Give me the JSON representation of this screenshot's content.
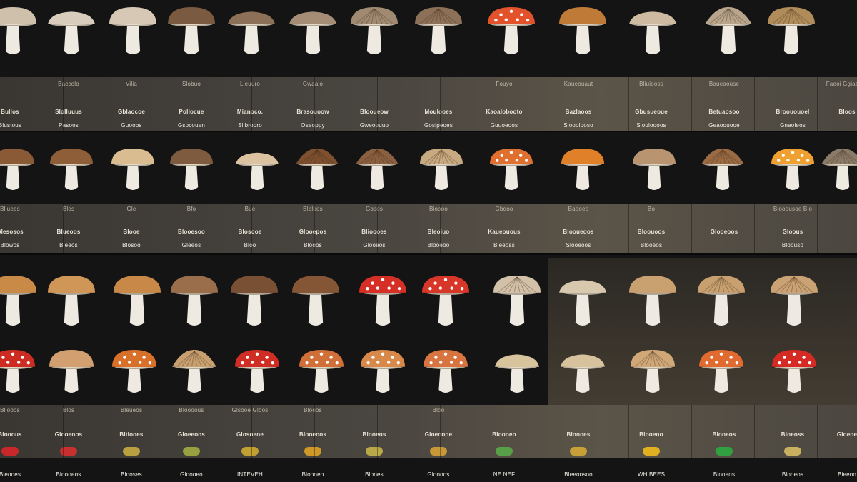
{
  "palette": {
    "background": "#141414",
    "label_band": "#4a4640",
    "stem": "#eeeae2",
    "cap_red": "#d93a2a",
    "cap_orange": "#e07a2a",
    "cap_brown": "#7a5236",
    "cap_tan": "#c8a478",
    "spot": "#ffffff"
  },
  "rows": [
    {
      "name": "row-1",
      "mushrooms": [
        {
          "cap": "#cfc0ab",
          "shape": "dome"
        },
        {
          "cap": "#d8ccbc",
          "shape": "flat"
        },
        {
          "cap": "#d6c8b4",
          "shape": "dome"
        },
        {
          "cap": "#7a5a40",
          "shape": "dome"
        },
        {
          "cap": "#8c7058",
          "shape": "flat"
        },
        {
          "cap": "#a58c74",
          "shape": "flat"
        },
        {
          "cap": "#a08a72",
          "shape": "gill"
        },
        {
          "cap": "#8d7058",
          "shape": "gill"
        },
        {
          "cap": "#e2532c",
          "shape": "spotted"
        },
        {
          "cap": "#c07a38",
          "shape": "dome"
        },
        {
          "cap": "#cdbaa0",
          "shape": "flat"
        },
        {
          "cap": "#b9a58c",
          "shape": "textured"
        },
        {
          "cap": "#b08c5a",
          "shape": "gill"
        }
      ],
      "labels_top": [
        "",
        "Baccolo",
        "Vilia",
        "Slobuo",
        "Lleuuro",
        "Gwaalo",
        "",
        "",
        "Fouyo",
        "Kaueouaut",
        "Bliuiooss",
        "Baueaouse",
        "",
        "Faeoi Ggiaesdli"
      ],
      "labels_mid": [
        "Bullos",
        "Slolluuus",
        "Gblaocoe",
        "Pollocue",
        "Mianoco.",
        "Brasouoow",
        "Blooueow",
        "Moulooes",
        "Kaoalobooto",
        "Bazlaoos",
        "Gbusueoue",
        "Betuaosoo",
        "Broououoel",
        "Bloos"
      ],
      "labels_low": [
        "Blustous",
        "Pasoos",
        "Guoobs",
        "Gsocouen",
        "Sllbrooro",
        "Oseoppy",
        "Gweoouuo",
        "Goslpeoes",
        "Guuoeoos",
        "Slooolooso",
        "Slouloooos",
        "Geaoouooe",
        "Gnaoleos"
      ]
    },
    {
      "name": "row-2",
      "mushrooms": [
        {
          "cap": "#8a5a36",
          "shape": "dome"
        },
        {
          "cap": "#8e5e38",
          "shape": "dome"
        },
        {
          "cap": "#d9bc90",
          "shape": "dome"
        },
        {
          "cap": "#7e5a3e",
          "shape": "dome"
        },
        {
          "cap": "#dcc2a0",
          "shape": "flat"
        },
        {
          "cap": "#7e5030",
          "shape": "textured"
        },
        {
          "cap": "#8a6040",
          "shape": "textured"
        },
        {
          "cap": "#c8aa80",
          "shape": "gill"
        },
        {
          "cap": "#e07030",
          "shape": "spotted"
        },
        {
          "cap": "#e08028",
          "shape": "dome"
        },
        {
          "cap": "#b89470",
          "shape": "dome"
        },
        {
          "cap": "#9a6a44",
          "shape": "textured"
        },
        {
          "cap": "#f0a030",
          "shape": "spotted"
        },
        {
          "cap": "#8a7a68",
          "shape": "textured"
        }
      ],
      "labels_top": [
        "Bliuees",
        "Bles",
        "Gle",
        "Bfo",
        "Bue",
        "Blbleos",
        "Gbsos",
        "Bioaoo",
        "Gbooo",
        "Baooeo",
        "Bo",
        "",
        "Blooousoe Blo"
      ],
      "labels_mid": [
        "Glesosos",
        "Blueoos",
        "Blooe",
        "Blooesoo",
        "Blosooe",
        "Glooepos",
        "Blioooes",
        "Bleoiuo",
        "Kaueouous",
        "Blooueoos",
        "Bloouoos",
        "Glooeoos",
        "Gloous"
      ],
      "labels_low": [
        "Blowos",
        "Bleeos",
        "Blosoo",
        "Gleeos",
        "Bloo",
        "Blooos",
        "Glooeos",
        "Blooeoo",
        "Bleeoss",
        "Slooeoos",
        "Blooeos",
        "",
        "Bloouso"
      ]
    },
    {
      "name": "row-3",
      "mushrooms": [
        {
          "cap": "#c98a48",
          "shape": "dome"
        },
        {
          "cap": "#d09658",
          "shape": "dome"
        },
        {
          "cap": "#c88848",
          "shape": "dome"
        },
        {
          "cap": "#9a6e4a",
          "shape": "dome"
        },
        {
          "cap": "#7a5034",
          "shape": "dome"
        },
        {
          "cap": "#845636",
          "shape": "dome"
        },
        {
          "cap": "#d63026",
          "shape": "spotted"
        },
        {
          "cap": "#d83628",
          "shape": "spotted"
        },
        {
          "cap": "#d2c0a8",
          "shape": "gill"
        },
        {
          "cap": "#d8c8ae",
          "shape": "flat"
        },
        {
          "cap": "#c9a070",
          "shape": "dome"
        },
        {
          "cap": "#c8a070",
          "shape": "gill"
        },
        {
          "cap": "#caa274",
          "shape": "gill"
        }
      ]
    },
    {
      "name": "row-4",
      "mushrooms": [
        {
          "cap": "#cc2c22",
          "shape": "spotted"
        },
        {
          "cap": "#d2a070",
          "shape": "dome"
        },
        {
          "cap": "#d8702a",
          "shape": "spotted"
        },
        {
          "cap": "#c8a070",
          "shape": "textured"
        },
        {
          "cap": "#d02e24",
          "shape": "spotted"
        },
        {
          "cap": "#d07038",
          "shape": "spotted"
        },
        {
          "cap": "#d88848",
          "shape": "spotted"
        },
        {
          "cap": "#d87440",
          "shape": "spotted"
        },
        {
          "cap": "#d8c49c",
          "shape": "flat"
        },
        {
          "cap": "#d6c29c",
          "shape": "flat"
        },
        {
          "cap": "#d0a878",
          "shape": "gill"
        },
        {
          "cap": "#e06a30",
          "shape": "spotted"
        },
        {
          "cap": "#d62a24",
          "shape": "spotted"
        }
      ],
      "labels_top": [
        "Bllooos",
        "Blos",
        "Bleueos",
        "Bloooous",
        "Glsooe Gloos",
        "Blooos",
        "",
        "Bloo",
        "",
        "",
        "",
        "",
        "",
        ""
      ],
      "labels_mid": [
        "Blooous",
        "Glooeoos",
        "Bltlooes",
        "Gloeeoos",
        "Glosoeoe",
        "Blooeoos",
        "Blooeos",
        "Gloeoooe",
        "Bloooeo",
        "Bloooes",
        "Blooeoo",
        "Blooeos",
        "Bloeoss",
        "Gloeoe"
      ],
      "swatches": [
        "#c8282a",
        "#c83030",
        "#b8a040",
        "#98a040",
        "#c0a030",
        "#d09828",
        "#b8a848",
        "#c89838",
        "#58a048",
        "#c8a038",
        "#e0b020",
        "#30a040",
        "#c8b060"
      ],
      "labels_low": [
        "Bleooes",
        "Bloooeos",
        "Blooses",
        "Gloooeo",
        "INTEVEH",
        "Bloooeo",
        "Blooes",
        "Gloooos",
        "NE NEF",
        "Bleeoosoo",
        "WH BEES",
        "Blooeos",
        "Blooeos",
        "Bieeoo"
      ]
    }
  ]
}
